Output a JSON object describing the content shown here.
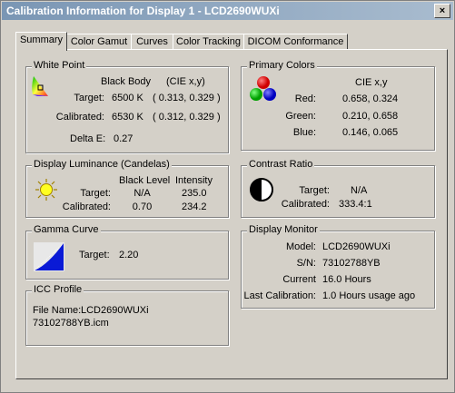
{
  "window": {
    "title": "Calibration Information for Display 1 - LCD2690WUXi",
    "close_label": "×"
  },
  "tabs": [
    {
      "label": "Summary"
    },
    {
      "label": "Color Gamut"
    },
    {
      "label": "Curves"
    },
    {
      "label": "Color Tracking"
    },
    {
      "label": "DICOM Conformance"
    }
  ],
  "white_point": {
    "title": "White Point",
    "col_black_body": "Black Body",
    "col_cie": "(CIE x,y)",
    "target_label": "Target:",
    "target_temp": "6500 K",
    "target_xy": "( 0.313, 0.329 )",
    "calibrated_label": "Calibrated:",
    "calibrated_temp": "6530 K",
    "calibrated_xy": "( 0.312, 0.329 )",
    "delta_e_label": "Delta E:",
    "delta_e": "0.27"
  },
  "primary_colors": {
    "title": "Primary Colors",
    "col_cie": "CIE x,y",
    "red_label": "Red:",
    "red_value": "0.658, 0.324",
    "green_label": "Green:",
    "green_value": "0.210, 0.658",
    "blue_label": "Blue:",
    "blue_value": "0.146, 0.065"
  },
  "luminance": {
    "title": "Display Luminance (Candelas)",
    "col_black": "Black Level",
    "col_intensity": "Intensity",
    "target_label": "Target:",
    "target_black": "N/A",
    "target_intensity": "235.0",
    "calibrated_label": "Calibrated:",
    "calibrated_black": "0.70",
    "calibrated_intensity": "234.2"
  },
  "contrast": {
    "title": "Contrast Ratio",
    "target_label": "Target:",
    "target_value": "N/A",
    "calibrated_label": "Calibrated:",
    "calibrated_value": "333.4:1"
  },
  "gamma": {
    "title": "Gamma Curve",
    "target_label": "Target:",
    "target_value": "2.20"
  },
  "monitor": {
    "title": "Display Monitor",
    "model_label": "Model:",
    "model_value": "LCD2690WUXi",
    "sn_label": "S/N:",
    "sn_value": "73102788YB",
    "current_label": "Current",
    "current_value": "16.0 Hours",
    "last_label": "Last Calibration:",
    "last_value": "1.0 Hours usage ago"
  },
  "icc": {
    "title": "ICC Profile",
    "file_label": "File Name:",
    "file_name_line1": "LCD2690WUXi",
    "file_name_line2": "73102788YB.icm"
  },
  "colors": {
    "gamma_fill": "#0a1ad6",
    "title_gradient_start": "#7a96b4",
    "title_gradient_end": "#a9bccf"
  }
}
